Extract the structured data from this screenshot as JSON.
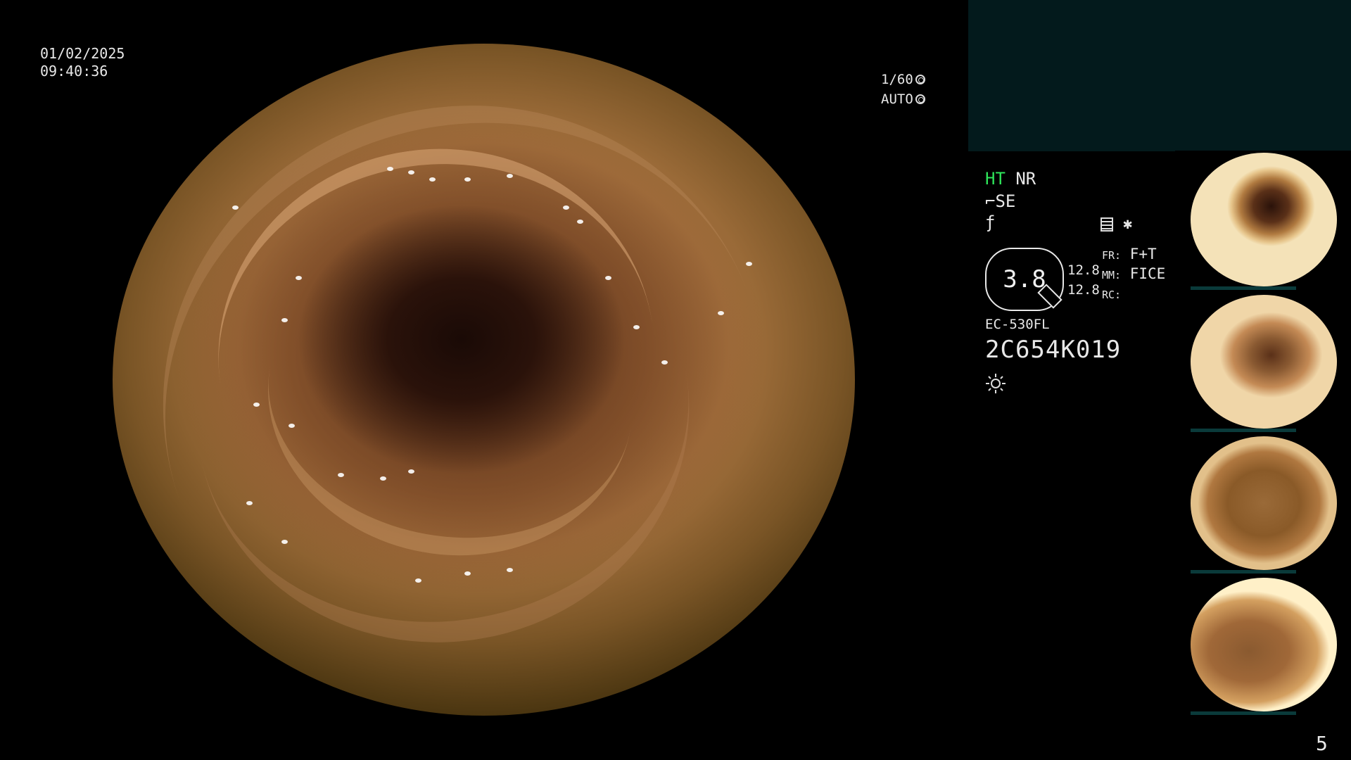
{
  "overlay": {
    "date": "01/02/2025",
    "time": "09:40:36",
    "shutter_speed": "1/60",
    "iris_mode": "AUTO"
  },
  "status": {
    "ht": "HT",
    "nr": "NR",
    "se": "SE"
  },
  "indicator": {
    "value": "3.8",
    "val1": "12.8",
    "val2": "12.8",
    "fr_label": "FR:",
    "fr_value": "F+T",
    "mm_label": "MM:",
    "mm_value": "FICE",
    "rc_label": "RC:"
  },
  "scope": {
    "model": "EC-530FL",
    "serial": "2C654K019"
  },
  "page_number": "5",
  "thumbnails": [
    {
      "label": "captured-image-1"
    },
    {
      "label": "captured-image-2"
    },
    {
      "label": "captured-image-3"
    },
    {
      "label": "captured-image-4"
    }
  ],
  "icons": [
    "shutter-icon",
    "iris-icon",
    "se-icon",
    "enhance-icon",
    "list-icon",
    "asterisk-icon",
    "light-icon"
  ],
  "colors": {
    "ht": "#2ee55a",
    "panel": "#031a1c"
  }
}
